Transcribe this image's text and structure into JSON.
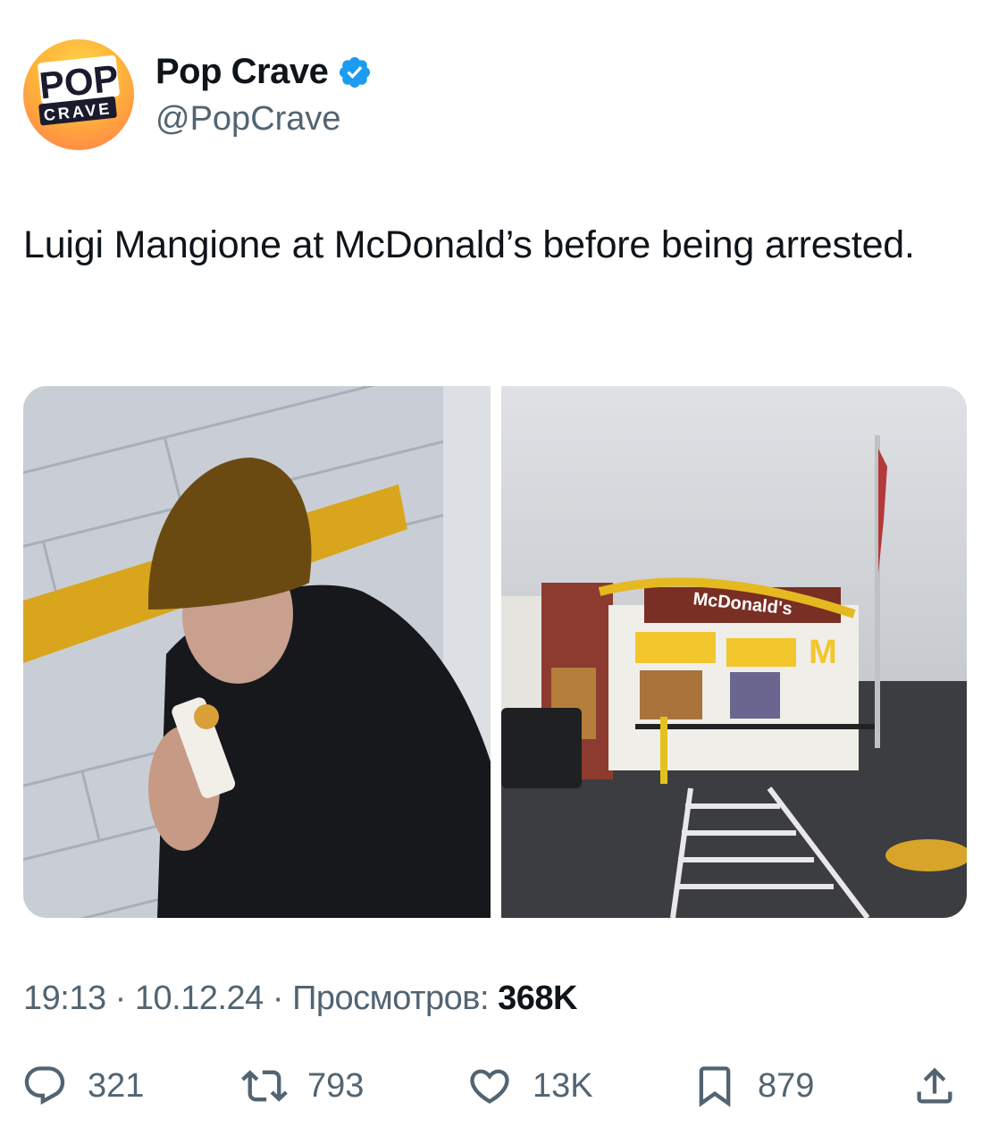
{
  "author": {
    "display_name": "Pop Crave",
    "handle": "@PopCrave",
    "avatar_text_top": "POP",
    "avatar_text_bottom": "CRAVE",
    "verified_icon": "verified-badge-icon",
    "accent_color": "#1d9bf0"
  },
  "tweet": {
    "text": "Luigi Mangione at McDonald’s before being arrested."
  },
  "media": {
    "right_photo_sign_text": "McDonald's",
    "right_photo_logo_text": "M"
  },
  "meta": {
    "time": "19:13",
    "date": "10.12.24",
    "views_label": "Просмотров:",
    "views_count": "368K",
    "separator": "·"
  },
  "actions": {
    "reply_count": "321",
    "retweet_count": "793",
    "like_count": "13K",
    "bookmark_count": "879"
  },
  "colors": {
    "text_primary": "#0f1419",
    "text_secondary": "#536471"
  }
}
